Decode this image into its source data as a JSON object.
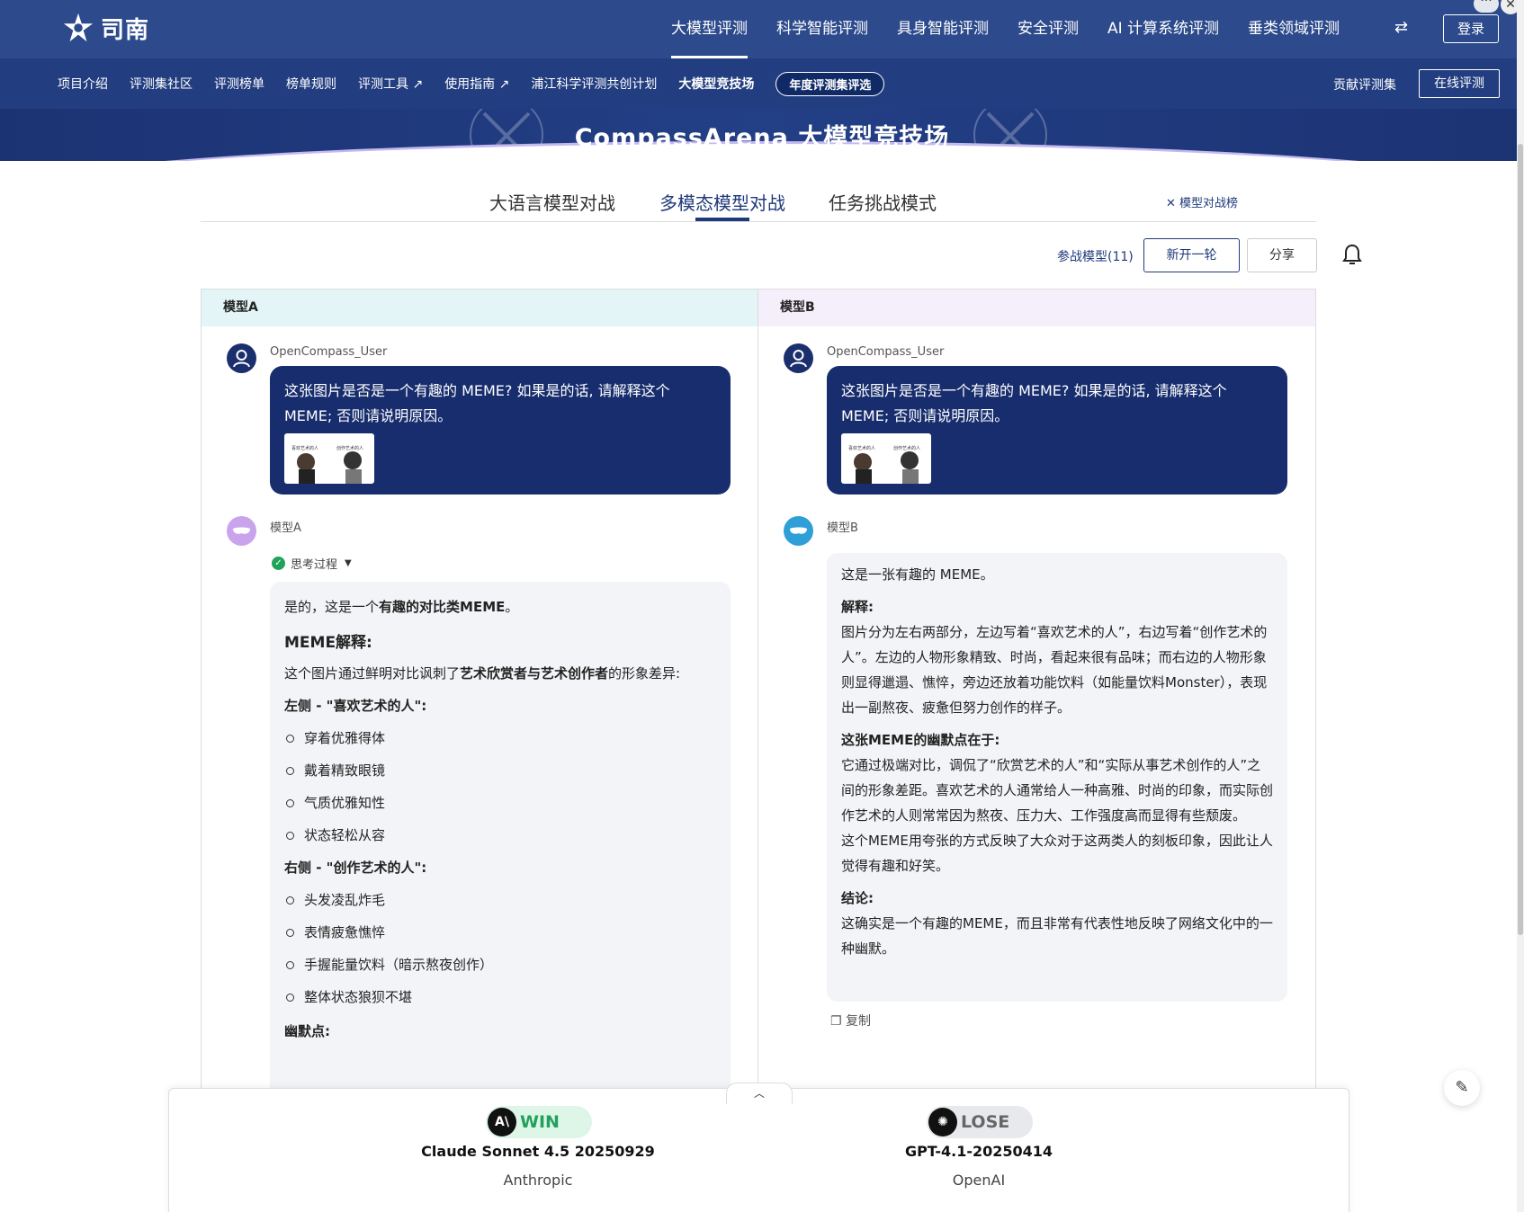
{
  "brand": {
    "name": "司南"
  },
  "topnav": {
    "items": [
      "大模型评测",
      "科学智能评测",
      "具身智能评测",
      "安全评测",
      "AI 计算系统评测",
      "垂类领域评测"
    ],
    "active": "大模型评测",
    "login": "登录"
  },
  "subnav": {
    "items": [
      "项目介绍",
      "评测集社区",
      "评测榜单",
      "榜单规则",
      "评测工具 ↗",
      "使用指南 ↗",
      "浦江科学评测共创计划"
    ],
    "current": "大模型竞技场",
    "pill": "年度评测集评选",
    "contribute": "贡献评测集",
    "online": "在线评测"
  },
  "banner": {
    "title": "CompassArena 大模型竞技场"
  },
  "modes": {
    "tabs": [
      "大语言模型对战",
      "多模态模型对战",
      "任务挑战模式"
    ],
    "active": "多模态模型对战",
    "rank_link": "模型对战榜"
  },
  "actions": {
    "participants": "参战模型(11)",
    "new_round": "新开一轮",
    "share": "分享"
  },
  "panels": {
    "a": {
      "header": "模型A",
      "user_name": "OpenCompass_User",
      "prompt": "这张图片是否是一个有趣的 MEME? 如果是的话, 请解释这个 MEME; 否则请说明原因。",
      "thumb_left": "喜欢艺术的人",
      "thumb_right": "创作艺术的人",
      "bot_name": "模型A",
      "think_label": "思考过程",
      "answer": {
        "intro_pre": "是的，这是一个",
        "intro_bold": "有趣的对比类MEME",
        "intro_post": "。",
        "heading": "MEME解释:",
        "desc_pre": "这个图片通过鲜明对比讽刺了",
        "desc_bold": "艺术欣赏者与艺术创作者",
        "desc_post": "的形象差异:",
        "left_title": "左侧 - \"喜欢艺术的人\":",
        "left_items": [
          "穿着优雅得体",
          "戴着精致眼镜",
          "气质优雅知性",
          "状态轻松从容"
        ],
        "right_title": "右侧 - \"创作艺术的人\":",
        "right_items": [
          "头发凌乱炸毛",
          "表情疲惫憔悴",
          "手握能量饮料（暗示熬夜创作）",
          "整体状态狼狈不堪"
        ],
        "humor_title": "幽默点:"
      }
    },
    "b": {
      "header": "模型B",
      "user_name": "OpenCompass_User",
      "prompt": "这张图片是否是一个有趣的 MEME? 如果是的话, 请解释这个 MEME; 否则请说明原因。",
      "thumb_left": "喜欢艺术的人",
      "thumb_right": "创作艺术的人",
      "bot_name": "模型B",
      "answer": {
        "line1": "这是一张有趣的 MEME。",
        "h1": "解释:",
        "p1": "图片分为左右两部分，左边写着“喜欢艺术的人”，右边写着“创作艺术的人”。左边的人物形象精致、时尚，看起来很有品味；而右边的人物形象则显得邋遢、憔悴，旁边还放着功能饮料（如能量饮料Monster），表现出一副熬夜、疲惫但努力创作的样子。",
        "h2": "这张MEME的幽默点在于:",
        "p2": "它通过极端对比，调侃了“欣赏艺术的人”和“实际从事艺术创作的人”之间的形象差距。喜欢艺术的人通常给人一种高雅、时尚的印象，而实际创作艺术的人则常常因为熬夜、压力大、工作强度高而显得有些颓废。",
        "p3": "这个MEME用夸张的方式反映了大众对于这两类人的刻板印象，因此让人觉得有趣和好笑。",
        "h3": "结论:",
        "p4": "这确实是一个有趣的MEME，而且非常有代表性地反映了网络文化中的一种幽默。"
      },
      "copy": "复制"
    }
  },
  "result": {
    "a": {
      "status": "WIN",
      "model": "Claude Sonnet 4.5 20250929",
      "org": "Anthropic",
      "logo": "A\\"
    },
    "b": {
      "status": "LOSE",
      "model": "GPT-4.1-20250414",
      "org": "OpenAI",
      "logo": "✺"
    }
  },
  "colors": {
    "nav": "#2c4a8c",
    "subnav": "#233e80",
    "bubble": "#172d6d",
    "win": "#21a15b"
  }
}
